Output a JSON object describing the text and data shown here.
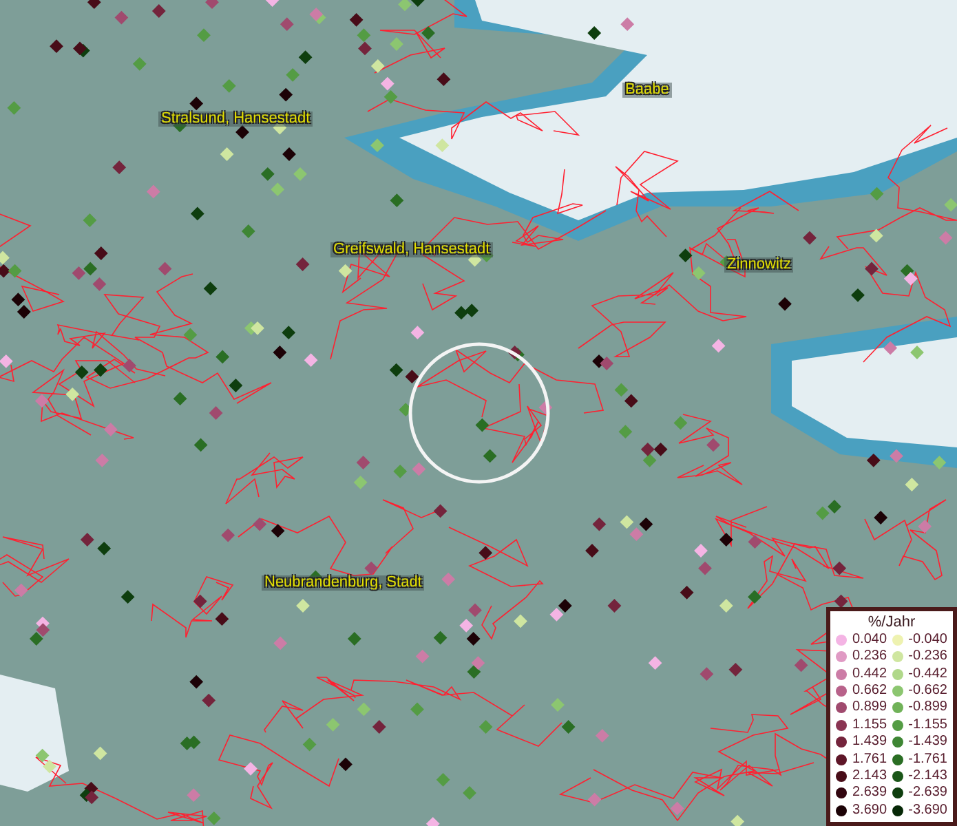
{
  "map": {
    "places": [
      {
        "name": "Baabe"
      },
      {
        "name": "Stralsund, Hansestadt"
      },
      {
        "name": "Greifswald, Hansestadt"
      },
      {
        "name": "Zinnowitz"
      },
      {
        "name": "Neubrandenburg, Stadt"
      }
    ]
  },
  "legend": {
    "title": "%/Jahr",
    "columns": [
      [
        {
          "value": "0.040",
          "color": "#f4b4e4"
        },
        {
          "value": "0.236",
          "color": "#e09ac4"
        },
        {
          "value": "0.442",
          "color": "#cc7ca6"
        },
        {
          "value": "0.662",
          "color": "#b8628a"
        },
        {
          "value": "0.899",
          "color": "#a04a6e"
        },
        {
          "value": "1.155",
          "color": "#8a3452"
        },
        {
          "value": "1.439",
          "color": "#74243c"
        },
        {
          "value": "1.761",
          "color": "#5e1628"
        },
        {
          "value": "2.143",
          "color": "#480c18"
        },
        {
          "value": "2.639",
          "color": "#320610"
        },
        {
          "value": "3.690",
          "color": "#1c0206"
        }
      ],
      [
        {
          "value": "-0.040",
          "color": "#eef2b0"
        },
        {
          "value": "-0.236",
          "color": "#cfe6a0"
        },
        {
          "value": "-0.442",
          "color": "#b0d88a"
        },
        {
          "value": "-0.662",
          "color": "#8cc670"
        },
        {
          "value": "-0.899",
          "color": "#70b258"
        },
        {
          "value": "-1.155",
          "color": "#549c44"
        },
        {
          "value": "-1.439",
          "color": "#3e8634"
        },
        {
          "value": "-1.761",
          "color": "#2a6e24"
        },
        {
          "value": "-2.143",
          "color": "#1a5618"
        },
        {
          "value": "-2.639",
          "color": "#0e3e0e"
        },
        {
          "value": "-3.690",
          "color": "#062806"
        }
      ]
    ]
  }
}
